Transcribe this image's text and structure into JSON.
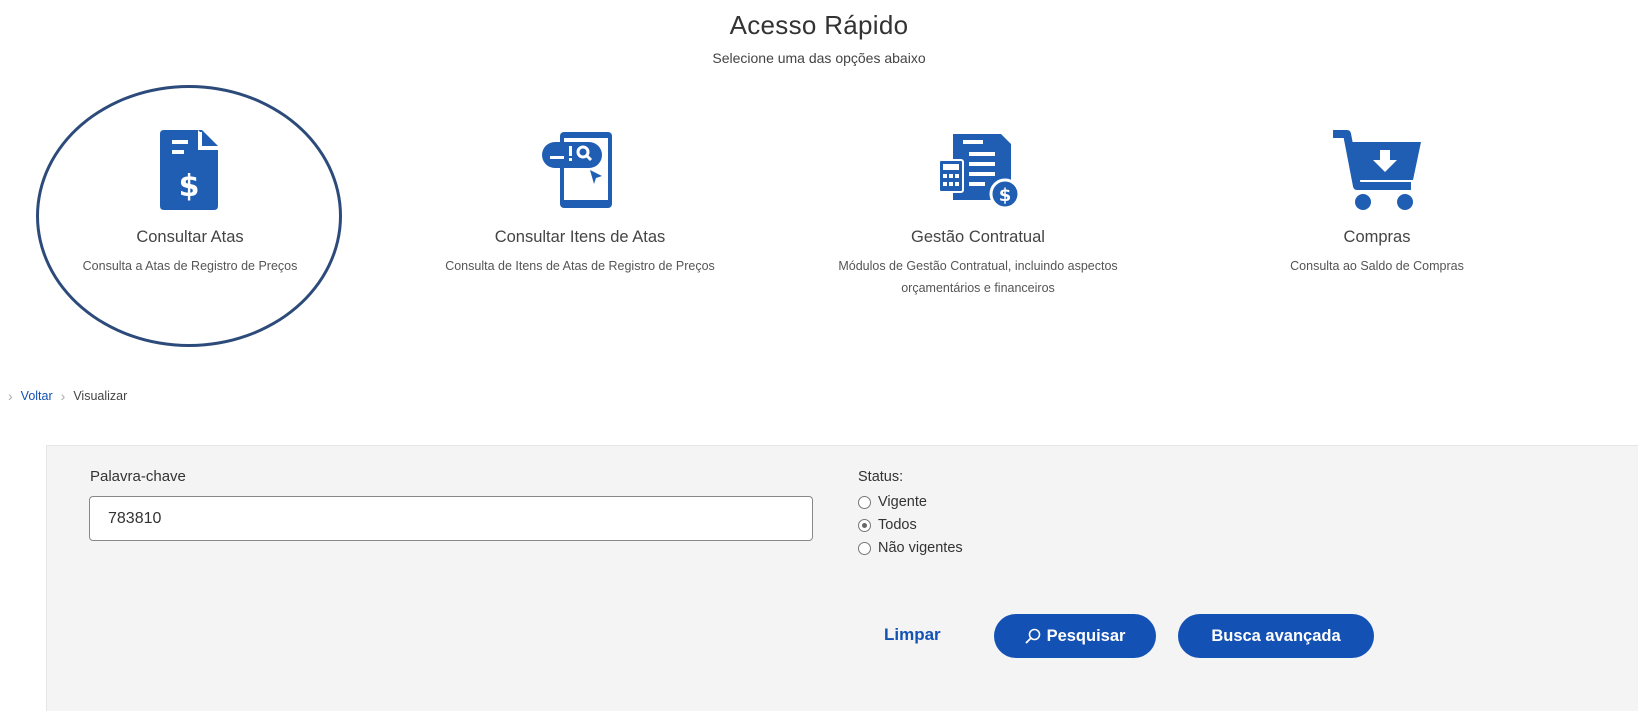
{
  "header": {
    "title": "Acesso Rápido",
    "subtitle": "Selecione uma das opções abaixo"
  },
  "cards": [
    {
      "title": "Consultar Atas",
      "desc": "Consulta a Atas de Registro de Preços",
      "icon": "document-dollar-icon"
    },
    {
      "title": "Consultar Itens de Atas",
      "desc": "Consulta de Itens de Atas de Registro de Preços",
      "icon": "tablet-search-icon"
    },
    {
      "title": "Gestão Contratual",
      "desc_line1": "Módulos de Gestão Contratual, incluindo aspectos",
      "desc_line2": "orçamentários e financeiros",
      "icon": "contract-calculator-icon"
    },
    {
      "title": "Compras",
      "desc": "Consulta ao Saldo de Compras",
      "icon": "cart-download-icon"
    }
  ],
  "breadcrumb": {
    "back": "Voltar",
    "current": "Visualizar"
  },
  "search": {
    "keyword_label": "Palavra-chave",
    "keyword_value": "783810",
    "status_label": "Status:",
    "status_options": [
      "Vigente",
      "Todos",
      "Não vigentes"
    ],
    "status_selected": "Todos",
    "clear_label": "Limpar",
    "search_label": "Pesquisar",
    "advanced_label": "Busca avançada"
  },
  "colors": {
    "brand_blue": "#1351b4",
    "icon_blue": "#1f5eb3",
    "highlight_circle": "#2d4b7a",
    "panel_bg": "#f4f4f4"
  }
}
